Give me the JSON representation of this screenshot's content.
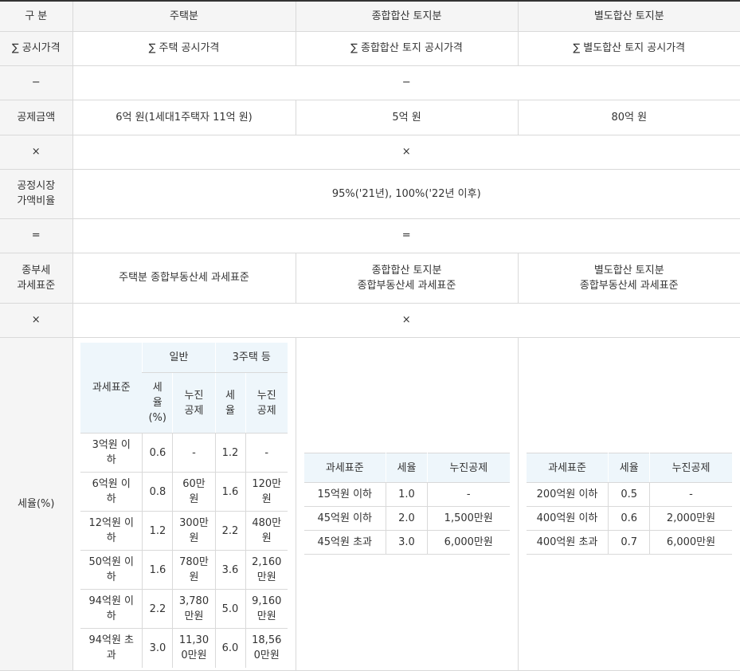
{
  "header": {
    "col1": "구 분",
    "col2": "주택분",
    "col3": "종합합산 토지분",
    "col4": "별도합산 토지분"
  },
  "row_price": {
    "label": "∑ 공시가격",
    "housing": "∑ 주택 공시가격",
    "comprehensive": "∑ 종합합산 토지 공시가격",
    "separate": "∑ 별도합산 토지 공시가격"
  },
  "row_minus": {
    "label": "−",
    "value": "−"
  },
  "row_deduction": {
    "label": "공제금액",
    "housing": "6억 원(1세대1주택자 11억 원)",
    "comprehensive": "5억 원",
    "separate": "80억 원"
  },
  "row_times1": {
    "label": "×",
    "value": "×"
  },
  "row_ratio": {
    "label_line1": "공정시장",
    "label_line2": "가액비율",
    "value": "95%('21년), 100%('22년 이후)"
  },
  "row_equals": {
    "label": "=",
    "value": "="
  },
  "row_base": {
    "label_line1": "종부세",
    "label_line2": "과세표준",
    "housing": "주택분 종합부동산세 과세표준",
    "comprehensive_line1": "종합합산 토지분",
    "comprehensive_line2": "종합부동산세 과세표준",
    "separate_line1": "별도합산 토지분",
    "separate_line2": "종합부동산세 과세표준"
  },
  "row_times2": {
    "label": "×",
    "value": "×"
  },
  "row_rate": {
    "label": "세율(%)"
  },
  "housing_rates": {
    "head_base": "과세표준",
    "head_general": "일반",
    "head_multi": "3주택 등",
    "head_rate_1": "세",
    "head_rate_2": "율",
    "head_rate_3": "(%)",
    "head_deduct_1": "누진",
    "head_deduct_2": "공제",
    "head_rate_m1": "세",
    "head_rate_m2": "율",
    "head_deduct_m1": "누진",
    "head_deduct_m2": "공제",
    "rows": [
      {
        "base1": "3억원 이",
        "base2": "하",
        "rate": "0.6",
        "deduct1": "-",
        "deduct2": "",
        "mrate": "1.2",
        "mdeduct1": "-",
        "mdeduct2": ""
      },
      {
        "base1": "6억원 이",
        "base2": "하",
        "rate": "0.8",
        "deduct1": "60만",
        "deduct2": "원",
        "mrate": "1.6",
        "mdeduct1": "120만",
        "mdeduct2": "원"
      },
      {
        "base1": "12억원 이",
        "base2": "하",
        "rate": "1.2",
        "deduct1": "300만",
        "deduct2": "원",
        "mrate": "2.2",
        "mdeduct1": "480만",
        "mdeduct2": "원"
      },
      {
        "base1": "50억원 이",
        "base2": "하",
        "rate": "1.6",
        "deduct1": "780만",
        "deduct2": "원",
        "mrate": "3.6",
        "mdeduct1": "2,160",
        "mdeduct2": "만원"
      },
      {
        "base1": "94억원 이",
        "base2": "하",
        "rate": "2.2",
        "deduct1": "3,780",
        "deduct2": "만원",
        "mrate": "5.0",
        "mdeduct1": "9,160",
        "mdeduct2": "만원"
      },
      {
        "base1": "94억원 초",
        "base2": "과",
        "rate": "3.0",
        "deduct1": "11,30",
        "deduct2": "0만원",
        "mrate": "6.0",
        "mdeduct1": "18,56",
        "mdeduct2": "0만원"
      }
    ]
  },
  "comp_rates": {
    "head_base": "과세표준",
    "head_rate": "세율",
    "head_deduct": "누진공제",
    "rows": [
      {
        "base": "15억원 이하",
        "rate": "1.0",
        "deduct": "-"
      },
      {
        "base": "45억원 이하",
        "rate": "2.0",
        "deduct": "1,500만원"
      },
      {
        "base": "45억원 초과",
        "rate": "3.0",
        "deduct": "6,000만원"
      }
    ]
  },
  "sep_rates": {
    "head_base": "과세표준",
    "head_rate": "세율",
    "head_deduct": "누진공제",
    "rows": [
      {
        "base": "200억원 이하",
        "rate": "0.5",
        "deduct": "-"
      },
      {
        "base": "400억원 이하",
        "rate": "0.6",
        "deduct": "2,000만원"
      },
      {
        "base": "400억원 초과",
        "rate": "0.7",
        "deduct": "6,000만원"
      }
    ]
  }
}
